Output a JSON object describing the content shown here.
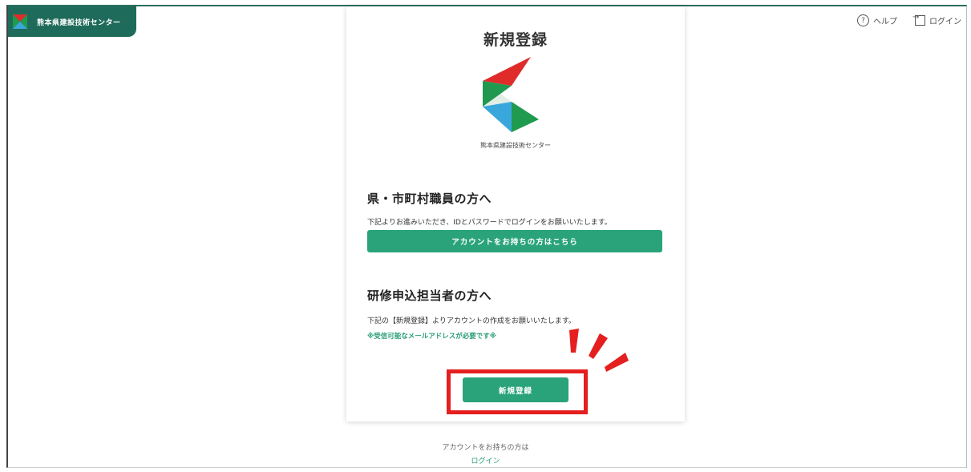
{
  "header": {
    "org_name": "熊本県建設技術センター",
    "help_label": "ヘルプ",
    "login_label": "ログイン"
  },
  "card": {
    "title": "新規登録",
    "org_name": "熊本県建設技術センター",
    "staff_section": {
      "heading": "県・市町村職員の方へ",
      "description": "下記よりお進みいただき、IDとパスワードでログインをお願いいたします。",
      "button_label": "アカウントをお持ちの方はこちら"
    },
    "applicant_section": {
      "heading": "研修申込担当者の方へ",
      "description": "下記の【新規登録】よりアカウントの作成をお願いいたします。",
      "note": "※受信可能なメールアドレスが必要です※",
      "button_label": "新規登録"
    }
  },
  "footer": {
    "question": "アカウントをお持ちの方は",
    "login_link": "ログイン"
  },
  "colors": {
    "brand_dark": "#1f6b5b",
    "accent_green": "#2aa37a",
    "highlight_red": "#e51f1f",
    "logo_red": "#e02b2b",
    "logo_green": "#1f9a4f",
    "logo_blue": "#3aa7dc"
  },
  "icons": [
    "brand-logo-icon",
    "help-icon",
    "login-icon"
  ]
}
